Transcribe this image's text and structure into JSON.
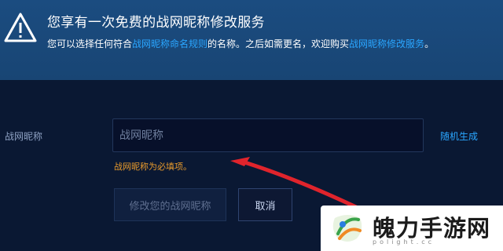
{
  "notice": {
    "icon": "warning-icon",
    "title": "您享有一次免费的战网昵称修改服务",
    "text_part1": "您可以选择任何符合",
    "rules_link": "战网昵称命名规则",
    "text_part2": "的名称。之后如需更名，欢迎购买",
    "service_link": "战网昵称修改服务",
    "text_part3": "。"
  },
  "form": {
    "label": "战网昵称",
    "placeholder": "战网昵称",
    "value": "",
    "random_link": "随机生成",
    "error": "战网昵称为必填项。",
    "submit_label": "修改您的战网昵称",
    "cancel_label": "取消"
  },
  "watermark": {
    "text": "魄力手游网",
    "subtext": "polight.cc"
  },
  "colors": {
    "notice_bg": "#1b4c80",
    "page_bg": "#0a1833",
    "link": "#2aa6ff",
    "error": "#e89a2c",
    "arrow": "#e0242c"
  }
}
